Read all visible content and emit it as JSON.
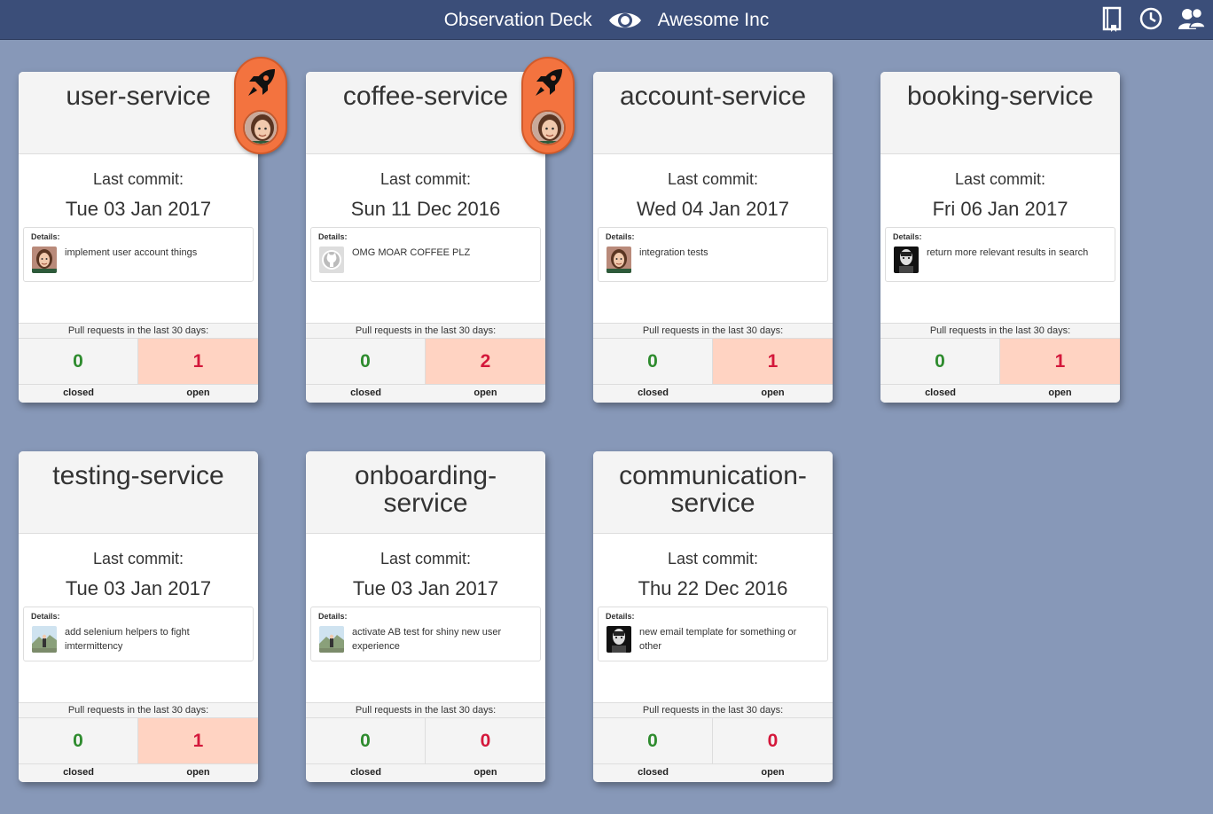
{
  "header": {
    "title": "Observation Deck",
    "org": "Awesome Inc",
    "icons": [
      "eye-icon",
      "journal-icon",
      "clock-icon",
      "users-icon"
    ]
  },
  "labels": {
    "last_commit": "Last commit:",
    "details": "Details:",
    "pr_caption": "Pull requests in the last 30 days:",
    "closed": "closed",
    "open": "open"
  },
  "colors": {
    "background": "#8798b8",
    "topbar": "#3b4e79",
    "badge": "#f3733f",
    "closed": "#2e8b2e",
    "open": "#d4183b",
    "open_highlight": "#ffd3c2"
  },
  "cards": [
    {
      "name": "user-service",
      "date": "Tue 03 Jan 2017",
      "message": "implement user account things",
      "avatar": "woman-avatar",
      "closed": "0",
      "open": "1",
      "open_highlight": true,
      "deploy_badge": true
    },
    {
      "name": "coffee-service",
      "date": "Sun 11 Dec 2016",
      "message": "OMG MOAR COFFEE PLZ",
      "avatar": "github-icon",
      "closed": "0",
      "open": "2",
      "open_highlight": true,
      "deploy_badge": true
    },
    {
      "name": "account-service",
      "date": "Wed 04 Jan 2017",
      "message": "integration tests",
      "avatar": "woman-avatar",
      "closed": "0",
      "open": "1",
      "open_highlight": true,
      "deploy_badge": false
    },
    {
      "name": "booking-service",
      "date": "Fri 06 Jan 2017",
      "message": "return more relevant results in search",
      "avatar": "bw-portrait-avatar",
      "closed": "0",
      "open": "1",
      "open_highlight": true,
      "deploy_badge": false
    },
    {
      "name": "testing-service",
      "date": "Tue 03 Jan 2017",
      "message": "add selenium helpers to fight imtermittency",
      "avatar": "landscape-avatar",
      "closed": "0",
      "open": "1",
      "open_highlight": true,
      "deploy_badge": false
    },
    {
      "name": "onboarding-service",
      "name_lines": [
        "onboarding-",
        "service"
      ],
      "date": "Tue 03 Jan 2017",
      "message": "activate AB test for shiny new user experience",
      "avatar": "landscape-avatar",
      "closed": "0",
      "open": "0",
      "open_highlight": false,
      "deploy_badge": false
    },
    {
      "name": "communication-service",
      "name_lines": [
        "communication-",
        "service"
      ],
      "date": "Thu 22 Dec 2016",
      "message": "new email template for something or other",
      "avatar": "bw-portrait-avatar",
      "closed": "0",
      "open": "0",
      "open_highlight": false,
      "deploy_badge": false
    }
  ]
}
